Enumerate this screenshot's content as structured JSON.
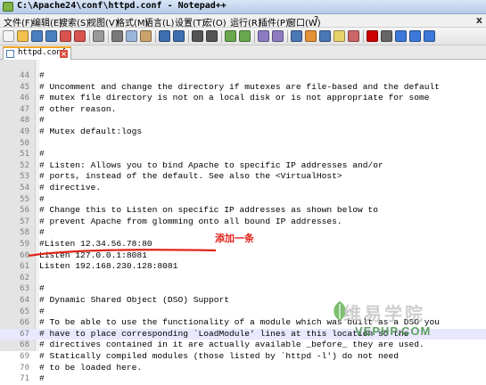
{
  "window": {
    "title": "C:\\Apache24\\conf\\httpd.conf - Notepad++",
    "close_glyph": "x"
  },
  "menu": {
    "items": [
      "文件(F)",
      "编辑(E)",
      "搜索(S)",
      "视图(V)",
      "格式(M)",
      "语言(L)",
      "设置(T)",
      "宏(O)",
      "运行(R)",
      "插件(P)",
      "窗口(W)",
      "?"
    ]
  },
  "toolbar": {
    "icons": [
      "new-file-icon",
      "open-file-icon",
      "save-icon",
      "save-all-icon",
      "close-icon",
      "close-all-icon",
      "print-icon",
      "cut-icon",
      "copy-icon",
      "paste-icon",
      "undo-icon",
      "redo-icon",
      "find-icon",
      "replace-icon",
      "zoom-in-icon",
      "zoom-out-icon",
      "sync-v-icon",
      "sync-h-icon",
      "word-wrap-icon",
      "show-all-chars-icon",
      "indent-guide-icon",
      "doc-map-icon",
      "function-list-icon",
      "record-macro-icon",
      "stop-macro-icon",
      "play-macro-icon",
      "run-macro-icon",
      "save-macro-icon"
    ]
  },
  "tab": {
    "label": "httpd.conf",
    "close_glyph": "×"
  },
  "editor": {
    "current_line": 67,
    "lines": [
      {
        "n": "44",
        "text": "#"
      },
      {
        "n": "45",
        "text": "# Uncomment and change the directory if mutexes are file-based and the default"
      },
      {
        "n": "46",
        "text": "# mutex file directory is not on a local disk or is not appropriate for some"
      },
      {
        "n": "47",
        "text": "# other reason."
      },
      {
        "n": "48",
        "text": "#"
      },
      {
        "n": "49",
        "text": "# Mutex default:logs"
      },
      {
        "n": "50",
        "text": ""
      },
      {
        "n": "51",
        "text": "#"
      },
      {
        "n": "52",
        "text": "# Listen: Allows you to bind Apache to specific IP addresses and/or"
      },
      {
        "n": "53",
        "text": "# ports, instead of the default. See also the <VirtualHost>"
      },
      {
        "n": "54",
        "text": "# directive."
      },
      {
        "n": "55",
        "text": "#"
      },
      {
        "n": "56",
        "text": "# Change this to Listen on specific IP addresses as shown below to"
      },
      {
        "n": "57",
        "text": "# prevent Apache from glomming onto all bound IP addresses."
      },
      {
        "n": "58",
        "text": "#"
      },
      {
        "n": "59",
        "text": "#Listen 12.34.56.78:80"
      },
      {
        "n": "60",
        "text": "Listen 127.0.0.1:8081"
      },
      {
        "n": "61",
        "text": "Listen 192.168.230.128:8081"
      },
      {
        "n": "62",
        "text": ""
      },
      {
        "n": "63",
        "text": "#"
      },
      {
        "n": "64",
        "text": "# Dynamic Shared Object (DSO) Support"
      },
      {
        "n": "65",
        "text": "#"
      },
      {
        "n": "66",
        "text": "# To be able to use the functionality of a module which was built as a DSO you"
      },
      {
        "n": "67",
        "text": "# have to place corresponding `LoadModule' lines at this location so the"
      },
      {
        "n": "68",
        "text": "# directives contained in it are actually available _before_ they are used."
      },
      {
        "n": "69",
        "text": "# Statically compiled modules (those listed by `httpd -l') do not need"
      },
      {
        "n": "70",
        "text": "# to be loaded here."
      },
      {
        "n": "71",
        "text": "#"
      }
    ]
  },
  "annotation": {
    "text": "添加一条",
    "color": "#e0241b"
  },
  "watermark": {
    "text": "维易学院",
    "sub": "VEPHP.COM"
  }
}
